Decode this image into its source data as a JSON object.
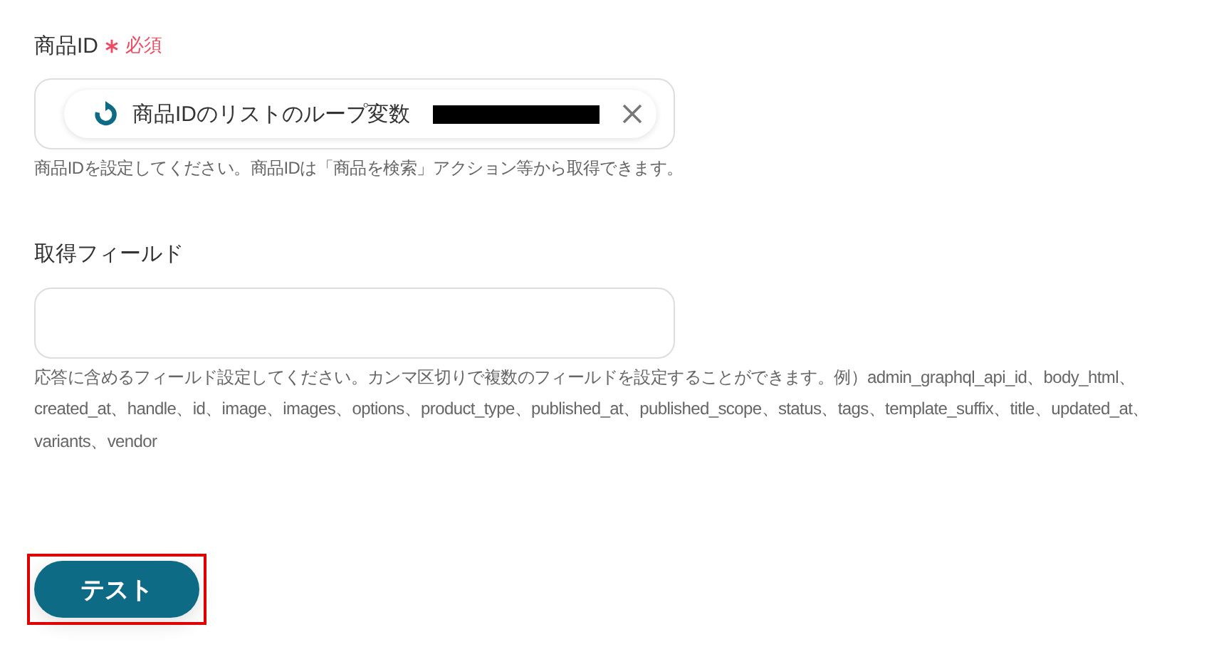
{
  "fields": [
    {
      "label": "商品ID",
      "required": true,
      "required_text": "必須",
      "chip": {
        "text": "商品IDのリストのループ変数",
        "redacted": true
      },
      "help": "商品IDを設定してください。商品IDは「商品を検索」アクション等から取得できます。"
    },
    {
      "label": "取得フィールド",
      "help": "応答に含めるフィールド設定してください。カンマ区切りで複数のフィールドを設定することができます。例）admin_graphql_api_id、body_html、created_at、handle、id、image、images、options、product_type、published_at、published_scope、status、tags、template_suffix、title、updated_at、variants、vendor"
    }
  ],
  "test_button": {
    "label": "テスト",
    "highlighted": true
  }
}
